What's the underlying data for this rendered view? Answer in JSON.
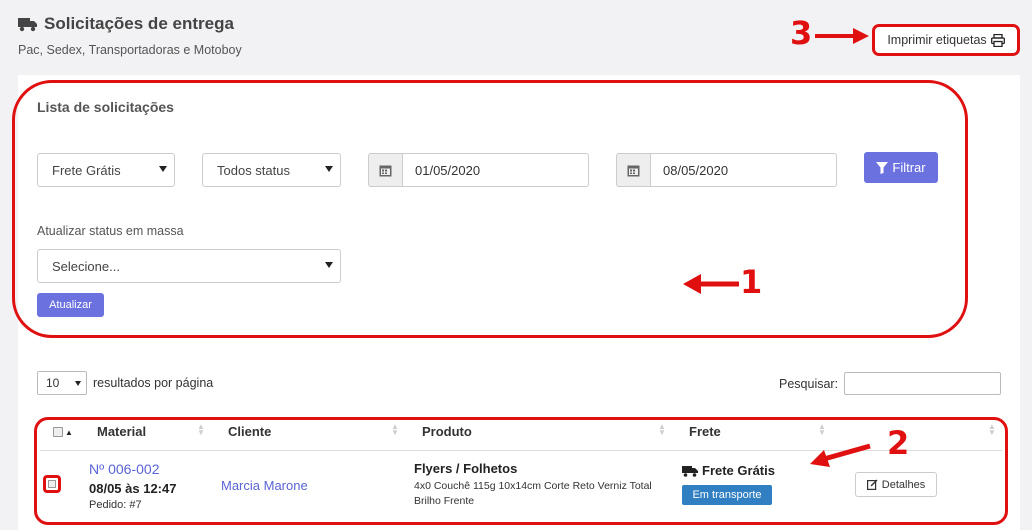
{
  "header": {
    "title": "Solicitações de entrega",
    "subtitle": "Pac, Sedex, Transportadoras e Motoboy",
    "title_icon": "truck-icon"
  },
  "print_button": {
    "label": "Imprimir etiquetas",
    "icon": "printer-icon"
  },
  "filters": {
    "title": "Lista de solicitações",
    "shipping_select": "Frete Grátis",
    "status_select": "Todos status",
    "date_from": "01/05/2020",
    "date_to": "08/05/2020",
    "filter_button": "Filtrar",
    "mass_update_label": "Atualizar status em massa",
    "mass_update_select": "Selecione...",
    "update_button": "Atualizar"
  },
  "table_controls": {
    "per_page_value": "10",
    "per_page_label": "resultados por página",
    "search_label": "Pesquisar:"
  },
  "table": {
    "columns": [
      "Material",
      "Cliente",
      "Produto",
      "Frete"
    ],
    "rows": [
      {
        "material_code": "Nº 006-002",
        "material_date": "08/05 às 12:47",
        "order": "Pedido: #7",
        "client": "Marcia Marone",
        "product_name": "Flyers / Folhetos",
        "product_desc": "4x0 Couchê 115g 10x14cm Corte Reto Verniz Total Brilho Frente",
        "shipping": "Frete Grátis",
        "status_badge": "Em transporte",
        "details_button": "Detalhes"
      }
    ]
  },
  "annotations": {
    "one": "1",
    "two": "2",
    "three": "3"
  },
  "colors": {
    "accent": "#6b72e0",
    "annotation": "#e01010",
    "badge": "#2f7fc2",
    "link": "#5a64d6"
  }
}
